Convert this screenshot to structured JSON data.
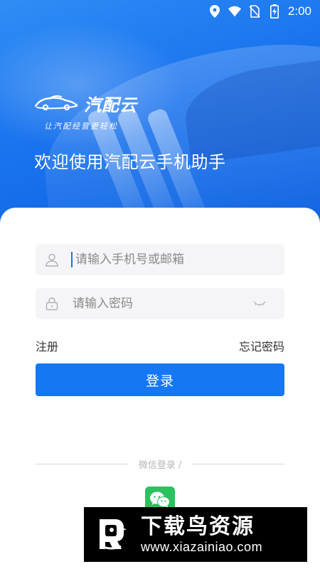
{
  "status_bar": {
    "time": "2:00",
    "icons": [
      "location-icon",
      "wifi-icon",
      "no-sim-icon",
      "battery-charging-icon"
    ]
  },
  "brand": {
    "name": "汽配云",
    "slogan": "让汽配经营更轻松"
  },
  "welcome_text": "欢迎使用汽配云手机助手",
  "form": {
    "account_placeholder": "请输入手机号或邮箱",
    "password_placeholder": "请输入密码",
    "register_label": "注册",
    "forgot_label": "忘记密码",
    "login_label": "登录"
  },
  "social": {
    "divider_text": "微信登录 /",
    "wechat_icon": "wechat-icon"
  },
  "watermark": {
    "title": "下载鸟资源",
    "url": "www.xiazainiao.com"
  },
  "colors": {
    "primary": "#1677f5",
    "hero": "#1a73ee",
    "wechat": "#2bc15f"
  }
}
